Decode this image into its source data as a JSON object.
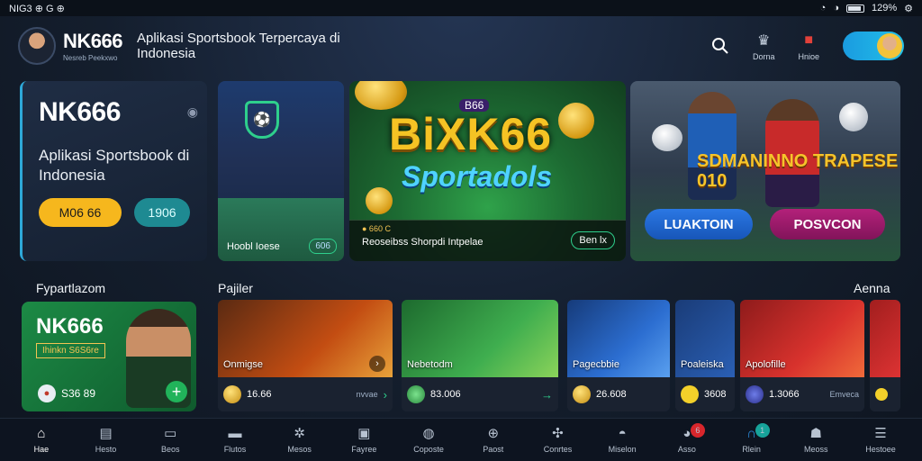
{
  "status_bar": {
    "left_text": "NIG3 ⊕ G ⊕",
    "right_text": "129%"
  },
  "header": {
    "brand_name": "NK666",
    "brand_sub": "Nesreb Peekxwo",
    "tagline": "Aplikasi Sportsbook Terpercaya di Indonesia",
    "actions": [
      {
        "label": "",
        "icon": "search-icon"
      },
      {
        "label": "Dorna",
        "icon": "trophy-icon"
      },
      {
        "label": "Hnioe",
        "icon": "gift-icon"
      }
    ]
  },
  "hero_card": {
    "title": "NK666",
    "description": "Aplikasi Sportsbook di Indonesia",
    "primary_button": "M06 66",
    "secondary_button": "1906"
  },
  "banners": {
    "b1": {
      "label": "Hoobl Ioese",
      "tag": "606"
    },
    "b2": {
      "logo": "BiXK66",
      "logo_sub": "Sportadols",
      "logo_top": "B66",
      "bar_small": "● 660 C",
      "bar_text": "Reoseibss Shorpdi Intpelae",
      "button": "Ben lx"
    },
    "b3": {
      "title": "SDMANINNO TRAPESE 010",
      "button_blue": "LUAKTOIN",
      "button_pink": "POSVCON"
    }
  },
  "sections": {
    "left": "Fypartlazom",
    "middle": "Pajiler",
    "right": "Aenna"
  },
  "promo_card": {
    "name": "NK666",
    "code": "Ihinkn S6S6re",
    "amount": "S36 89"
  },
  "games": [
    {
      "name": "Onmigse",
      "value": "16.66",
      "more": "nvvae"
    },
    {
      "name": "Nebetodm",
      "value": "83.006",
      "more": ""
    },
    {
      "name": "Pagecbbie",
      "value": "26.608",
      "more": ""
    },
    {
      "name": "Poaleiska",
      "value": "3608",
      "more": ""
    },
    {
      "name": "Apolofille",
      "value": "1.3066",
      "more": "Emveca"
    }
  ],
  "navbar": [
    {
      "label": "Hae",
      "icon": "home-icon",
      "active": true
    },
    {
      "label": "Hesto",
      "icon": "calendar-icon"
    },
    {
      "label": "Beos",
      "icon": "ticket-icon"
    },
    {
      "label": "Flutos",
      "icon": "card-icon"
    },
    {
      "label": "Mesos",
      "icon": "soccer-icon"
    },
    {
      "label": "Fayree",
      "icon": "gift-icon"
    },
    {
      "label": "Coposte",
      "icon": "chat-icon"
    },
    {
      "label": "Paost",
      "icon": "basketball-icon"
    },
    {
      "label": "Conrtes",
      "icon": "grid-icon"
    },
    {
      "label": "Miselon",
      "icon": "user-icon"
    },
    {
      "label": "Asso",
      "icon": "wallet-icon",
      "badge": "6"
    },
    {
      "label": "Rlein",
      "icon": "store-icon",
      "badge": "1"
    },
    {
      "label": "Meoss",
      "icon": "profile-icon"
    },
    {
      "label": "Hestoee",
      "icon": "menu-icon"
    }
  ],
  "colors": {
    "accent_yellow": "#f6b71d",
    "accent_teal": "#1e8a92",
    "accent_green": "#2ecf8c",
    "badge_red": "#d8262c",
    "badge_teal": "#17a39a"
  }
}
